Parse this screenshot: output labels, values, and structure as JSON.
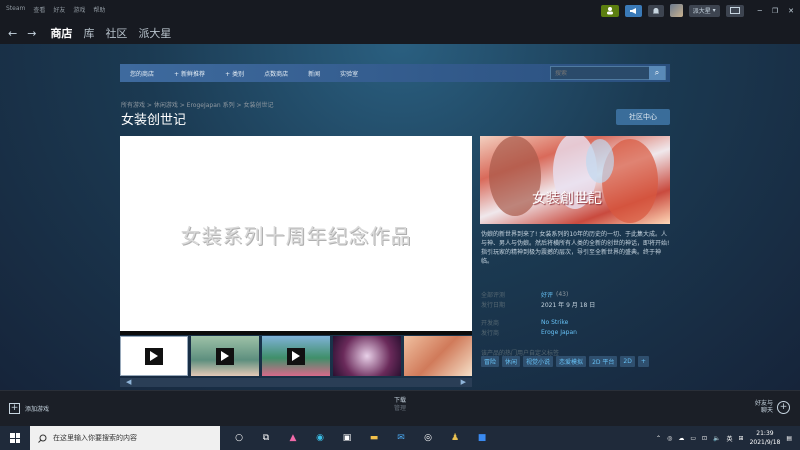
{
  "sysmenu": [
    "Steam",
    "查看",
    "好友",
    "游戏",
    "帮助"
  ],
  "sysright": {
    "username": "派大星"
  },
  "nav": {
    "tabs": [
      "商店",
      "库",
      "社区",
      "派大星"
    ],
    "active_index": 0
  },
  "subnav": {
    "items": [
      "您的商店",
      "新鲜推荐",
      "类别",
      "点数商店",
      "新闻",
      "实验室"
    ],
    "search_placeholder": "搜索"
  },
  "breadcrumb": "所有游戏 > 休闲游戏 > ErogeJapan 系列 > 女装创世记",
  "title": "女装创世记",
  "community_hub": "社区中心",
  "video": {
    "promo_text": "女装系列十周年纪念作品"
  },
  "cover": {
    "title": "女装創世記"
  },
  "description": "伪娘的新世界到来了! 女装系列的10年的历史的一切、于此集大成。人与神、男人与伪娘。然后将横所有人类的全新的创世的神话，即将开始! 指引玩家的精神到极为震撼的层次，导引至全新世界的盛典。终于神临。",
  "meta": {
    "reviews_label": "全部评测",
    "reviews_value": "好评",
    "reviews_count": "(43)",
    "release_label": "发行日期",
    "release_value": "2021 年 9 月 18 日",
    "developer_label": "开发商",
    "developer_value": "No Strike",
    "publisher_label": "发行商",
    "publisher_value": "Eroge Japan"
  },
  "tags_heading": "该产品的热门用户自定义标签",
  "tags": [
    "冒险",
    "休闲",
    "视觉小说",
    "恋爱模拟",
    "2D 平台",
    "2D",
    "+"
  ],
  "bottom": {
    "add_game": "添加游戏",
    "downloads": "下载",
    "downloads_sub": "管理",
    "friends_line1": "好友与",
    "friends_line2": "聊天"
  },
  "taskbar": {
    "search_placeholder": "在这里输入你要搜索的内容",
    "time": "21:39",
    "date": "2021/9/18",
    "lang": "英"
  }
}
